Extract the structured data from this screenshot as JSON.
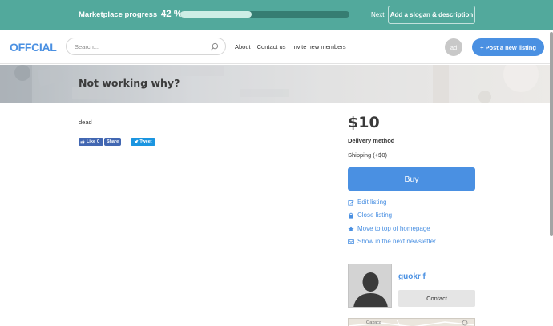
{
  "progress_banner": {
    "title": "Marketplace progress",
    "percent_label": "42 %",
    "progress_fraction": 0.42,
    "next_label": "Next",
    "slogan_button_label": "Add a slogan & description"
  },
  "header": {
    "logo": "OFFCIAL",
    "search_placeholder": "Search...",
    "nav": {
      "about": "About",
      "contact": "Contact us",
      "invite": "Invite new members"
    },
    "avatar_initials": "ad",
    "post_button_label": "+ Post a new listing"
  },
  "listing": {
    "title": "Not working why?",
    "description": "dead",
    "price": "$10",
    "delivery_heading": "Delivery method",
    "shipping_label": "Shipping (+$0)",
    "buy_label": "Buy"
  },
  "social": {
    "like_label": "Like",
    "like_count": "0",
    "share_label": "Share",
    "tweet_label": "Tweet"
  },
  "actions": {
    "edit": "Edit listing",
    "close": "Close listing",
    "move": "Move to top of homepage",
    "newsletter": "Show in the next newsletter"
  },
  "author": {
    "name": "guokr f",
    "contact_label": "Contact"
  },
  "map": {
    "label": "Oaxaca"
  },
  "colors": {
    "banner": "#52a99c",
    "accent": "#4a90e2",
    "facebook": "#4267b2",
    "twitter": "#1b95e0"
  }
}
